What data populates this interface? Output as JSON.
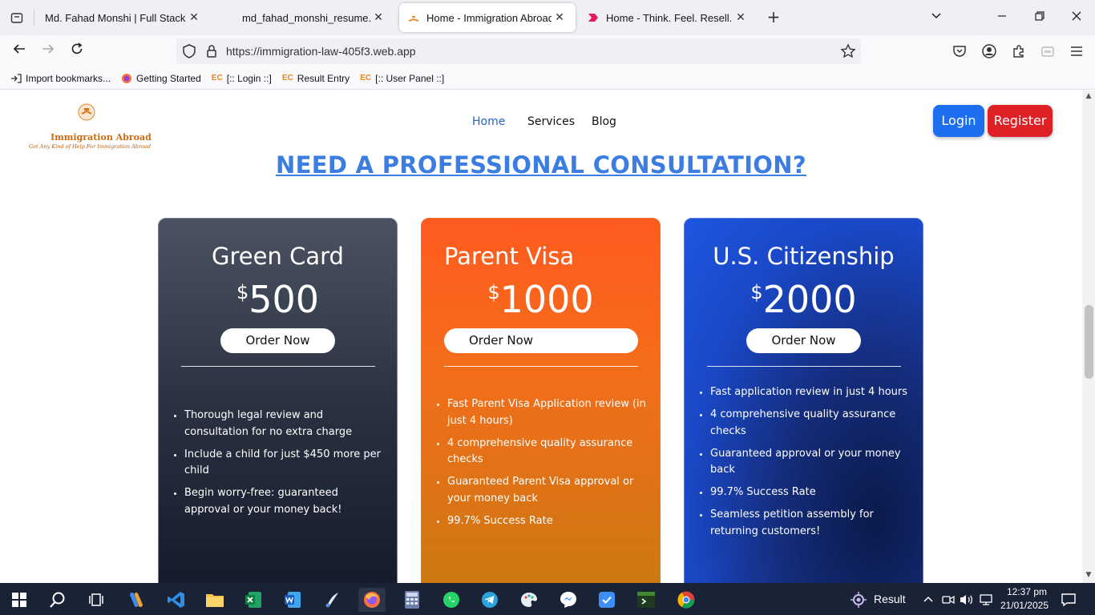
{
  "browser": {
    "tabs": [
      {
        "label": "Md. Fahad Monshi | Full Stack Devel",
        "active": false
      },
      {
        "label": "md_fahad_monshi_resume.pdf",
        "active": false
      },
      {
        "label": "Home - Immigration Abroad",
        "active": true
      },
      {
        "label": "Home - Think. Feel. Resell.",
        "active": false
      }
    ],
    "url": "https://immigration-law-405f3.web.app",
    "bookmarks": [
      "Import bookmarks...",
      "Getting Started",
      "[:: Login ::]",
      "Result Entry",
      "[:: User Panel ::]"
    ]
  },
  "site": {
    "logo_title": "Immigration Abroad",
    "logo_subtitle": "Get Any Kind of Help For Immigration Abroad",
    "nav": [
      "Home",
      "Services",
      "Blog"
    ],
    "login_label": "Login",
    "register_label": "Register",
    "heading": "NEED A PROFESSIONAL CONSULTATION?",
    "cards": [
      {
        "title": "Green Card",
        "currency": "$",
        "price": "500",
        "button": "Order Now",
        "features": [
          "Thorough legal review and consultation for no extra charge",
          "Include a child for just $450 more per child",
          "Begin worry-free: guaranteed approval or your money back!"
        ]
      },
      {
        "title": "Parent Visa",
        "currency": "$",
        "price": "1000",
        "button": "Order Now",
        "features": [
          "Fast Parent Visa Application review (in just 4 hours)",
          "4 comprehensive quality assurance checks",
          "Guaranteed Parent Visa approval or your money back",
          "99.7% Success Rate"
        ]
      },
      {
        "title": "U.S. Citizenship",
        "currency": "$",
        "price": "2000",
        "button": "Order Now",
        "features": [
          "Fast application review in just 4 hours",
          "4 comprehensive quality assurance checks",
          "Guaranteed approval or your money back",
          "99.7% Success Rate",
          "Seamless petition assembly for returning customers!"
        ]
      }
    ]
  },
  "taskbar": {
    "weather_label": "Result",
    "time": "12:37 pm",
    "date": "21/01/2025"
  },
  "colors": {
    "nav_active": "#2563c9",
    "login": "#1d6ff0",
    "register": "#de2127",
    "heading": "#3b7de0"
  }
}
